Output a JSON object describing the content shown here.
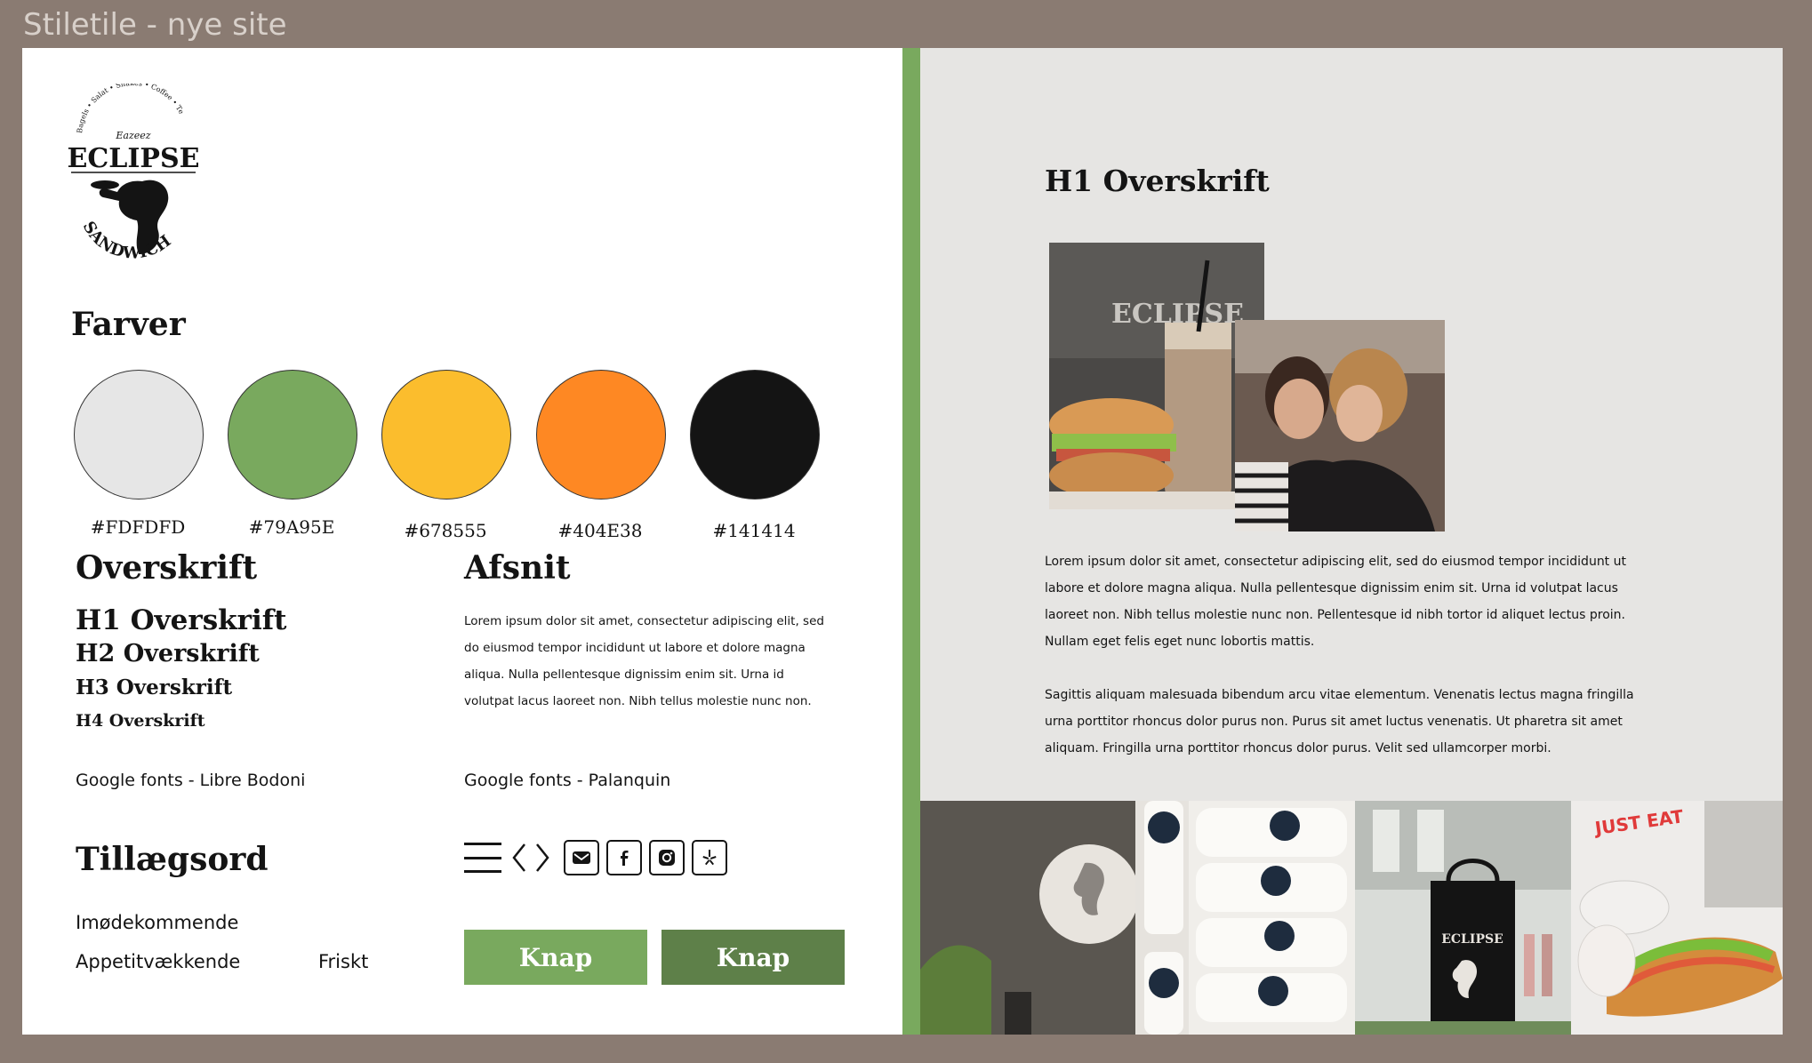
{
  "frame": {
    "title": "Stiletile - nye site"
  },
  "logo": {
    "arc_text": "Bagels • Salat • Shakes • Coffee • Te",
    "script": "Eazeez",
    "brand": "ECLIPSE",
    "sub": "SANDWICH"
  },
  "colors": {
    "title": "Farver",
    "swatches": [
      {
        "hex": "#FDFDFD",
        "fill": "#e6e6e6"
      },
      {
        "hex": "#79A95E",
        "fill": "#79a95e"
      },
      {
        "hex": "#678555",
        "fill": "#fbbd2d"
      },
      {
        "hex": "#404E38",
        "fill": "#fe8823"
      },
      {
        "hex": "#141414",
        "fill": "#141414"
      }
    ]
  },
  "typography": {
    "heading_title": "Overskrift",
    "h1": "H1 Overskrift",
    "h2": "H2 Overskrift",
    "h3": "H3 Overskrift",
    "h4": "H4 Overskrift",
    "heading_font": "Google fonts - Libre Bodoni",
    "paragraph_title": "Afsnit",
    "paragraph_lines": [
      "Lorem ipsum dolor sit amet, consectetur adipiscing elit, sed",
      "do eiusmod tempor incididunt ut labore et dolore magna",
      "aliqua.  Nulla pellentesque dignissim enim sit. Urna id",
      "volutpat lacus laoreet non. Nibh tellus molestie nunc non."
    ],
    "paragraph_font": "Google fonts - Palanquin"
  },
  "adjectives": {
    "title": "Tillægsord",
    "words": [
      "Imødekommende",
      "Appetitvækkende",
      "Friskt"
    ]
  },
  "icons": [
    "menu-icon",
    "chevron-left-icon",
    "chevron-right-icon",
    "mail-icon",
    "facebook-icon",
    "instagram-icon",
    "yelp-icon"
  ],
  "buttons": {
    "primary_label": "Knap",
    "secondary_label": "Knap"
  },
  "preview": {
    "h1": "H1 Overskrift",
    "para1": [
      "Lorem ipsum dolor sit amet, consectetur adipiscing elit, sed do eiusmod tempor incididunt ut",
      "labore et dolore magna aliqua. Nulla pellentesque dignissim enim sit. Urna id volutpat lacus",
      "laoreet non. Nibh tellus molestie nunc non. Pellentesque id nibh tortor id aliquet lectus proin.",
      "Nullam eget felis eget nunc lobortis mattis."
    ],
    "para2": [
      "Sagittis aliquam malesuada bibendum arcu vitae elementum. Venenatis lectus magna fringilla",
      "urna porttitor rhoncus dolor purus non. Purus sit amet luctus venenatis. Ut pharetra sit amet",
      "aliquam. Fringilla urna porttitor rhoncus dolor purus. Velit sed ullamcorper morbi."
    ],
    "photo_brand": "ECLIPSE",
    "just_eat": "JUST EAT"
  }
}
